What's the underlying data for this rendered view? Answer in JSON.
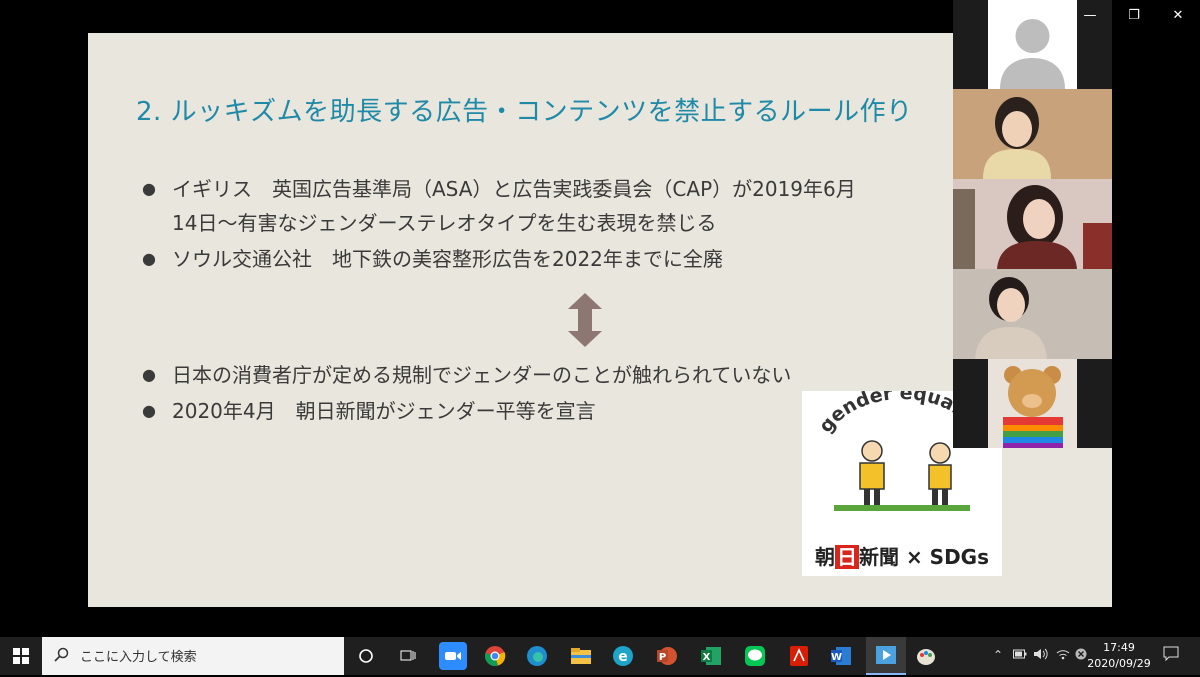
{
  "slide": {
    "title": "2. ルッキズムを助長する広告・コンテンツを禁止するルール作り",
    "bullets": [
      {
        "text": "イギリス　英国広告基準局（ASA）と広告実践委員会（CAP）が2019年6月",
        "cont": "14日〜有害なジェンダーステレオタイプを生む表現を禁じる"
      },
      {
        "text": "ソウル交通公社　地下鉄の美容整形広告を2022年までに全廃"
      },
      {
        "text": "日本の消費者庁が定める規制でジェンダーのことが触れられていない"
      },
      {
        "text": "2020年4月　朝日新聞がジェンダー平等を宣言"
      }
    ],
    "arrow_color": "#8c7772",
    "title_color": "#1f89a8",
    "background_color": "#e9e6dd"
  },
  "sticker": {
    "banner": "gender equality",
    "brand_red": "日",
    "brand_pre": "朝",
    "brand_post": "新聞",
    "sdgs": " × SDGs"
  },
  "taskbar": {
    "search_placeholder": "ここに入力して検索",
    "time": "17:49",
    "date": "2020/09/29",
    "apps": [
      "cortana-icon",
      "task-view-icon",
      "zoom-icon",
      "chrome-icon",
      "edge-icon",
      "file-explorer-icon",
      "ie-icon",
      "powerpoint-icon",
      "excel-icon",
      "line-icon",
      "acrobat-icon",
      "word-icon",
      "media-player-icon",
      "paint-icon"
    ]
  }
}
